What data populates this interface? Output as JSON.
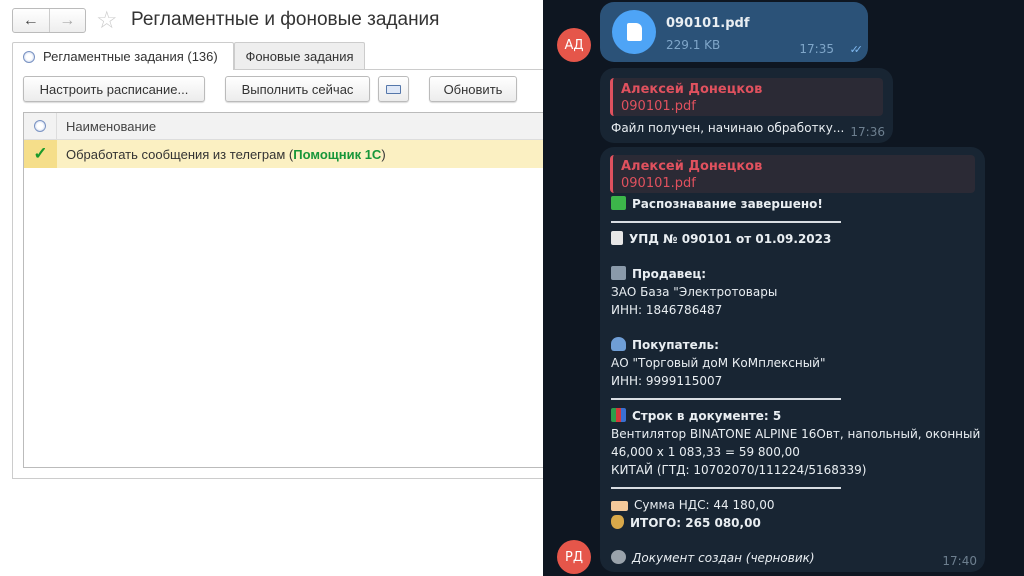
{
  "left": {
    "title": "Регламентные и фоновые задания",
    "nav": {
      "back": "←",
      "forward": "→"
    },
    "tabs": [
      {
        "label": "Регламентные задания (136)"
      },
      {
        "label": "Фоновые задания"
      }
    ],
    "toolbar": {
      "schedule": "Настроить расписание...",
      "run_now": "Выполнить сейчас",
      "refresh": "Обновить"
    },
    "grid": {
      "column": "Наименование",
      "rows": [
        {
          "name": "Обработать сообщения из телеграм (",
          "extension": "Помощник 1С",
          "suffix": ")",
          "status": "✓"
        }
      ]
    }
  },
  "chat": {
    "avatars": {
      "top": "АД",
      "bottom": "РД"
    },
    "file_msg": {
      "name": "090101.pdf",
      "size": "229.1 KB",
      "time": "17:35"
    },
    "msg2": {
      "reply_author": "Алексей Донецков",
      "reply_file": "090101.pdf",
      "text": "Файл получен, начинаю обработку...",
      "time": "17:36"
    },
    "msg3": {
      "reply_author": "Алексей Донецков",
      "reply_file": "090101.pdf",
      "done": "Распознавание завершено!",
      "doc": "УПД № 090101 от 01.09.2023",
      "seller_label": "Продавец:",
      "seller": "ЗАО База \"Электротовары",
      "seller_inn": "ИНН: 1846786487",
      "buyer_label": "Покупатель:",
      "buyer": "АО \"Торговый доМ КоМплексный\"",
      "buyer_inn": "ИНН: 9999115007",
      "rows": "Строк в документе: 5",
      "item": "Вентилятор BINATONE ALPINE 16Овт, напольный, оконный",
      "calc": "46,000 x 1 083,33 = 59 800,00",
      "origin": "КИТАЙ (ГТД: 10702070/111224/5168339)",
      "vat": "Сумма НДС: 44 180,00",
      "total": "ИТОГО: 265 080,00",
      "status": "Документ создан (черновик)",
      "time": "17:40"
    }
  }
}
